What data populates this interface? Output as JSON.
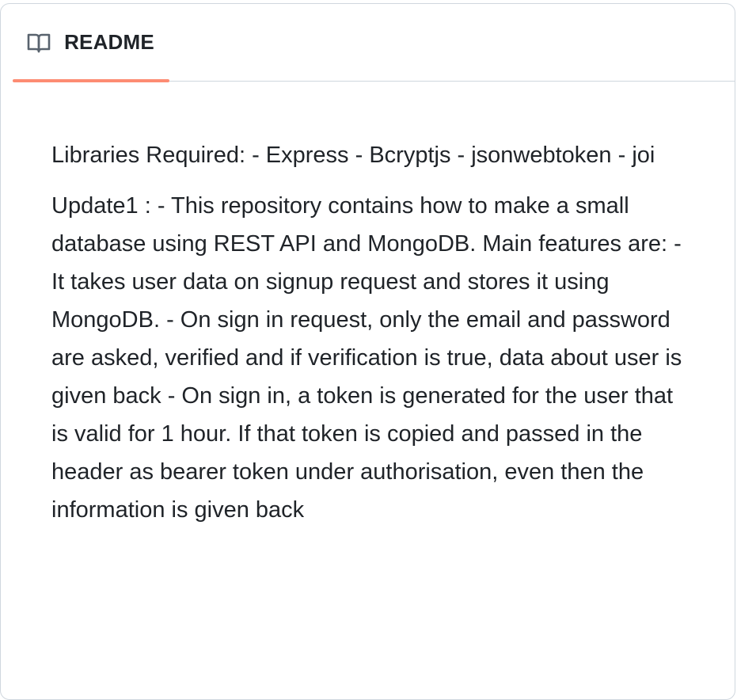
{
  "readme": {
    "tab": {
      "label": "README",
      "icon": "book-icon",
      "active": true,
      "accent_color": "#fd8c73"
    },
    "paragraphs": [
      "Libraries Required: - Express - Bcryptjs - jsonwebtoken - joi",
      "Update1 : - This repository contains how to make a small database using REST API and MongoDB. Main features are: - It takes user data on signup request and stores it using MongoDB. - On sign in request, only the email and password are asked, verified and if verification is true, data about user is given back - On sign in, a token is generated for the user that is valid for 1 hour. If that token is copied and passed in the header as bearer token under authorisation, even then the information is given back"
    ]
  }
}
